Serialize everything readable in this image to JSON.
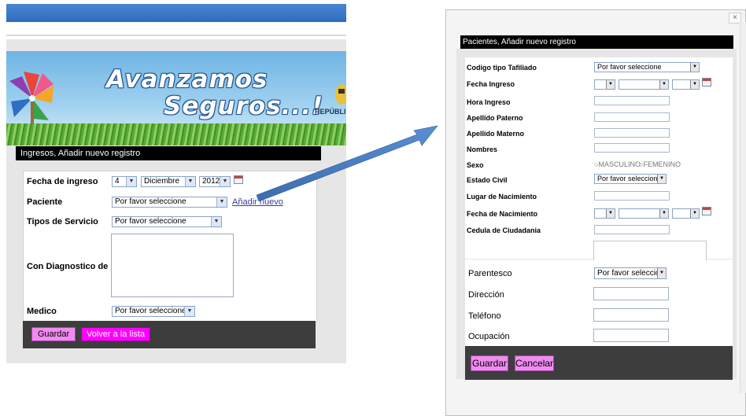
{
  "left": {
    "banner": {
      "slogan_line1": "Avanzamos",
      "slogan_line2": "Seguros...!",
      "republic": "REPÚBLIC"
    },
    "form": {
      "title": "Ingresos, Añadir nuevo registro",
      "fecha_label": "Fecha de ingreso",
      "fecha_day": "4",
      "fecha_month": "Diciembre",
      "fecha_year": "2012",
      "paciente_label": "Paciente",
      "paciente_value": "Por favor seleccione",
      "add_new_link": "Añadir nuevo",
      "tipos_label": "Tipos de Servicio",
      "tipos_value": "Por favor seleccione",
      "diagnostico_label": "Con Diagnostico de",
      "medico_label": "Medico",
      "medico_value": "Por favor seleccione",
      "save_button": "Guardar",
      "back_button": "Volver a la lista"
    }
  },
  "right": {
    "close_symbol": "×",
    "form": {
      "title": "Pacientes, Añadir nuevo registro",
      "codigo_label": "Codigo tipo Tafiliado",
      "codigo_value": "Por favor seleccione",
      "fecha_ingreso_label": "Fecha Ingreso",
      "hora_label": "Hora Ingreso",
      "apellido_paterno_label": "Apellido Paterno",
      "apellido_materno_label": "Apellido Materno",
      "nombres_label": "Nombres",
      "sexo_label": "Sexo",
      "sexo_masculino": "MASCULINO",
      "sexo_femenino": "FEMENINO",
      "estado_civil_label": "Estado Civil",
      "estado_civil_value": "Por favor seleccione",
      "lugar_label": "Lugar de Nacimiento",
      "fecha_nac_label": "Fecha de Nacimiento",
      "cedula_label": "Cedula de Ciudadania",
      "parentesco_label": "Parentesco",
      "parentesco_value": "Por favor seleccione",
      "direccion_label": "Dirección",
      "telefono_label": "Teléfono",
      "ocupacion_label": "Ocupación",
      "save_button": "Guardar",
      "cancel_button": "Cancelar"
    }
  },
  "colors": {
    "header_black": "#000000",
    "footer_dark": "#3d3d3d",
    "button_pink": "#f08cf0",
    "button_magenta": "#ff00ff",
    "arrow_blue": "#4a7fc1"
  }
}
